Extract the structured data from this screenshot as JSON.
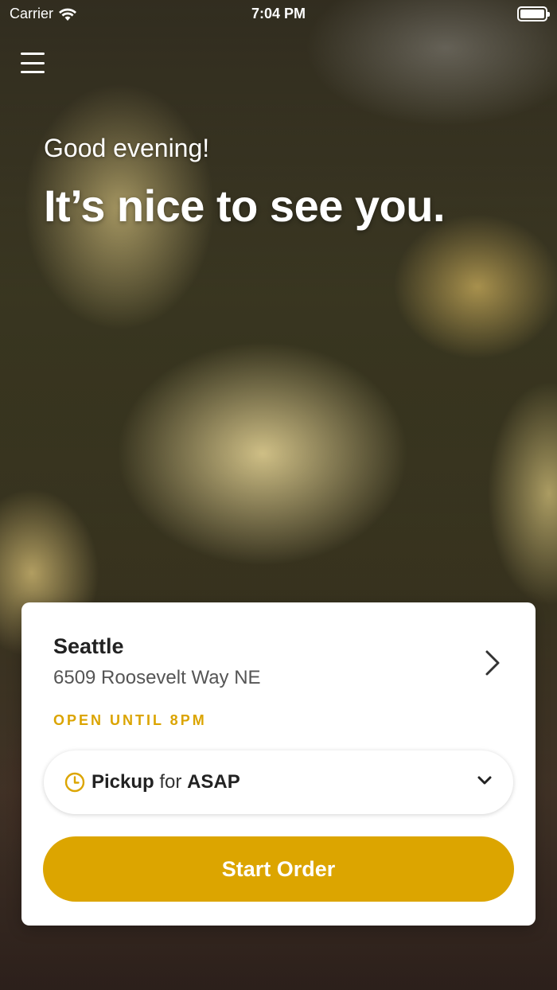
{
  "status_bar": {
    "carrier": "Carrier",
    "time": "7:04 PM"
  },
  "header": {
    "menu_icon": "hamburger-menu-icon"
  },
  "hero": {
    "greeting": "Good evening!",
    "headline": "It’s nice to see you."
  },
  "location_card": {
    "city": "Seattle",
    "address": "6509 Roosevelt Way NE",
    "open_status": "OPEN UNTIL 8PM",
    "pickup": {
      "mode": "Pickup",
      "connector": "for",
      "time": "ASAP"
    },
    "start_button": "Start Order"
  },
  "colors": {
    "accent": "#dca500",
    "open_status": "#dba400",
    "card_bg": "#ffffff"
  },
  "icons": {
    "wifi": "wifi-icon",
    "battery": "battery-icon",
    "location_chevron": "chevron-right-icon",
    "clock": "clock-icon",
    "dropdown": "chevron-down-icon"
  }
}
